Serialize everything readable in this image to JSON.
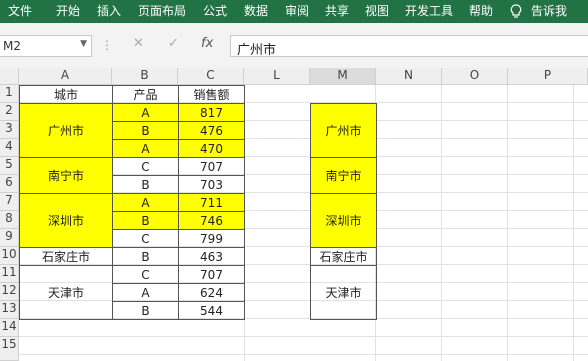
{
  "ribbon": {
    "tabs": [
      "文件",
      "开始",
      "插入",
      "页面布局",
      "公式",
      "数据",
      "审阅",
      "共享",
      "视图",
      "开发工具",
      "帮助"
    ],
    "tell_me": "告诉我",
    "tell_me_icon": "lightbulb-icon",
    "color": "#217346"
  },
  "formula_bar": {
    "name_box": "M2",
    "cancel_icon": "✕",
    "enter_icon": "✓",
    "fx_label": "fx",
    "formula": "广州市"
  },
  "columns": [
    "A",
    "B",
    "C",
    "L",
    "M",
    "N",
    "O",
    "P"
  ],
  "rows": [
    "1",
    "2",
    "3",
    "4",
    "5",
    "6",
    "7",
    "8",
    "9",
    "10",
    "11",
    "12",
    "13",
    "14",
    "15"
  ],
  "table": {
    "headers": [
      "城市",
      "产品",
      "销售额"
    ],
    "products": [
      "A",
      "B",
      "A",
      "C",
      "B",
      "A",
      "B",
      "C",
      "B",
      "C",
      "A",
      "B"
    ],
    "sales": [
      "817",
      "476",
      "470",
      "707",
      "703",
      "711",
      "746",
      "799",
      "463",
      "707",
      "624",
      "544"
    ],
    "cities": [
      "广州市",
      "南宁市",
      "深圳市",
      "石家庄市",
      "天津市"
    ]
  },
  "right_list": [
    "广州市",
    "南宁市",
    "深圳市",
    "石家庄市",
    "天津市"
  ],
  "highlight_color": "#ffff00"
}
